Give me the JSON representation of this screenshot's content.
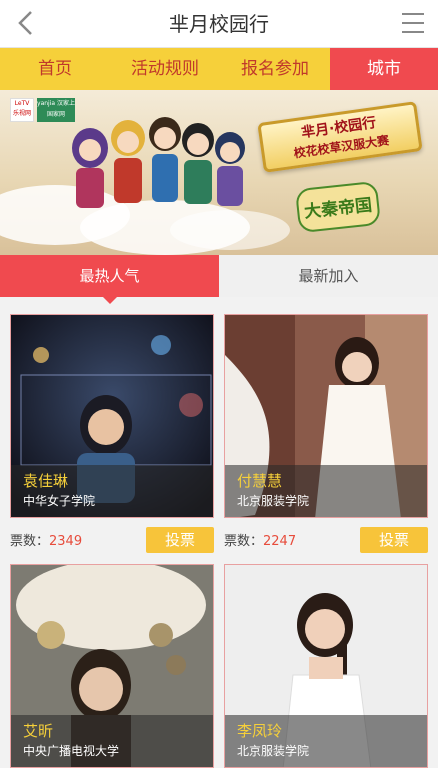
{
  "header": {
    "title": "芈月校园行"
  },
  "nav": {
    "items": [
      "首页",
      "活动规则",
      "报名参加",
      "城市"
    ]
  },
  "banner": {
    "logo_left": "LeTV 乐视网",
    "logo_right": "yanjia 汉家上国家网",
    "plaque_line1": "芈月·校园行",
    "plaque_line2": "校花校草汉服大赛",
    "game_logo": "大秦帝国"
  },
  "tabs": {
    "hot": "最热人气",
    "new": "最新加入"
  },
  "vote_label": "票数：",
  "vote_button": "投票",
  "contestants": [
    {
      "name": "袁佳琳",
      "school": "中华女子学院",
      "votes": "2349"
    },
    {
      "name": "付慧慧",
      "school": "北京服装学院",
      "votes": "2247"
    },
    {
      "name": "艾昕",
      "school": "中央广播电视大学"
    },
    {
      "name": "李凤玲",
      "school": "北京服装学院"
    }
  ],
  "colors": {
    "accent": "#f04a4f",
    "nav_bg": "#f6d03a",
    "button": "#f7c43a"
  }
}
